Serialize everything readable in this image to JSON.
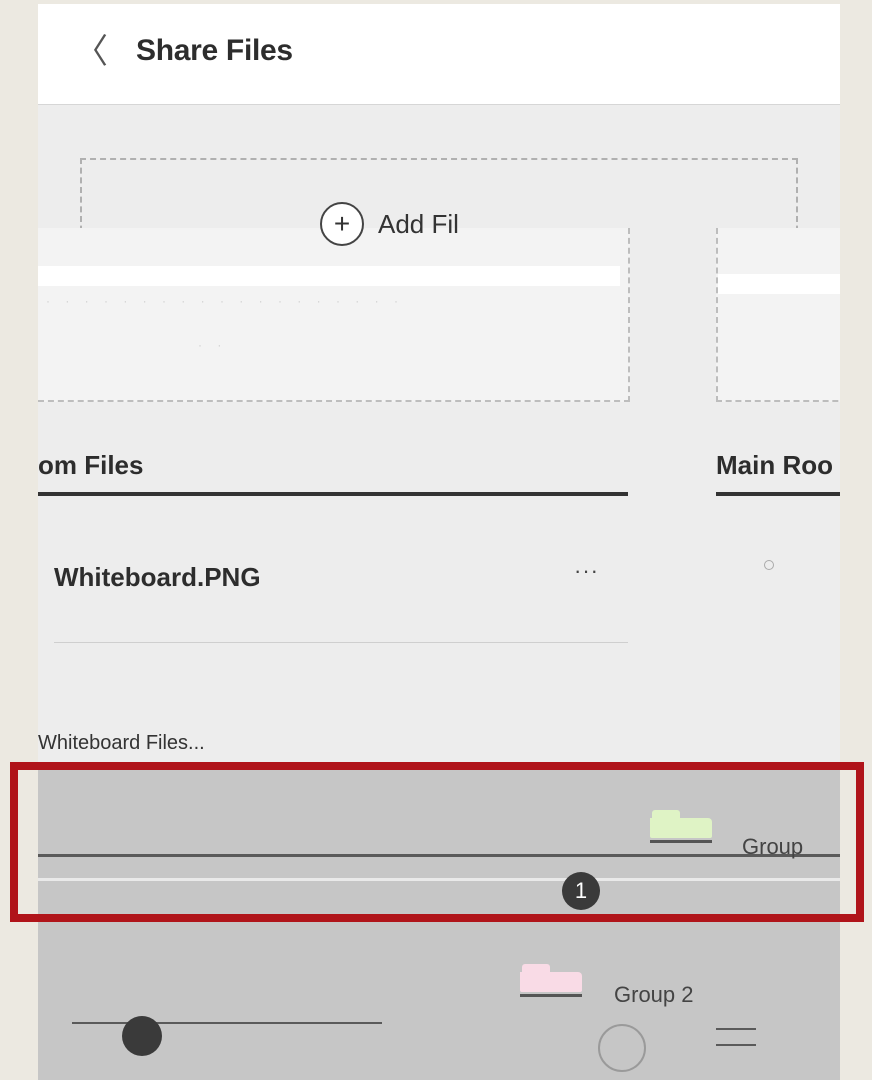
{
  "header": {
    "back_icon": "chevron-left-icon",
    "back_glyph": "〈",
    "title": "Share Files"
  },
  "upload": {
    "add_label": "Add Fil",
    "add_glyph": "+",
    "add_icon": "plus-circle-icon"
  },
  "columns": {
    "left_title": "om Files",
    "right_title": "Main Roo"
  },
  "files": [
    {
      "name": "Whiteboard.PNG",
      "more_label": "···"
    }
  ],
  "strip_text": "Whiteboard Files...",
  "groups": [
    {
      "label": "Group",
      "folder_color": "#dff3c5"
    },
    {
      "label": "Group 2",
      "folder_color": "#f9dbe6"
    }
  ],
  "badge_count": "1",
  "colors": {
    "highlight": "#b0141a",
    "page_bg": "#ece9e1",
    "panel_bg": "#ededed"
  }
}
